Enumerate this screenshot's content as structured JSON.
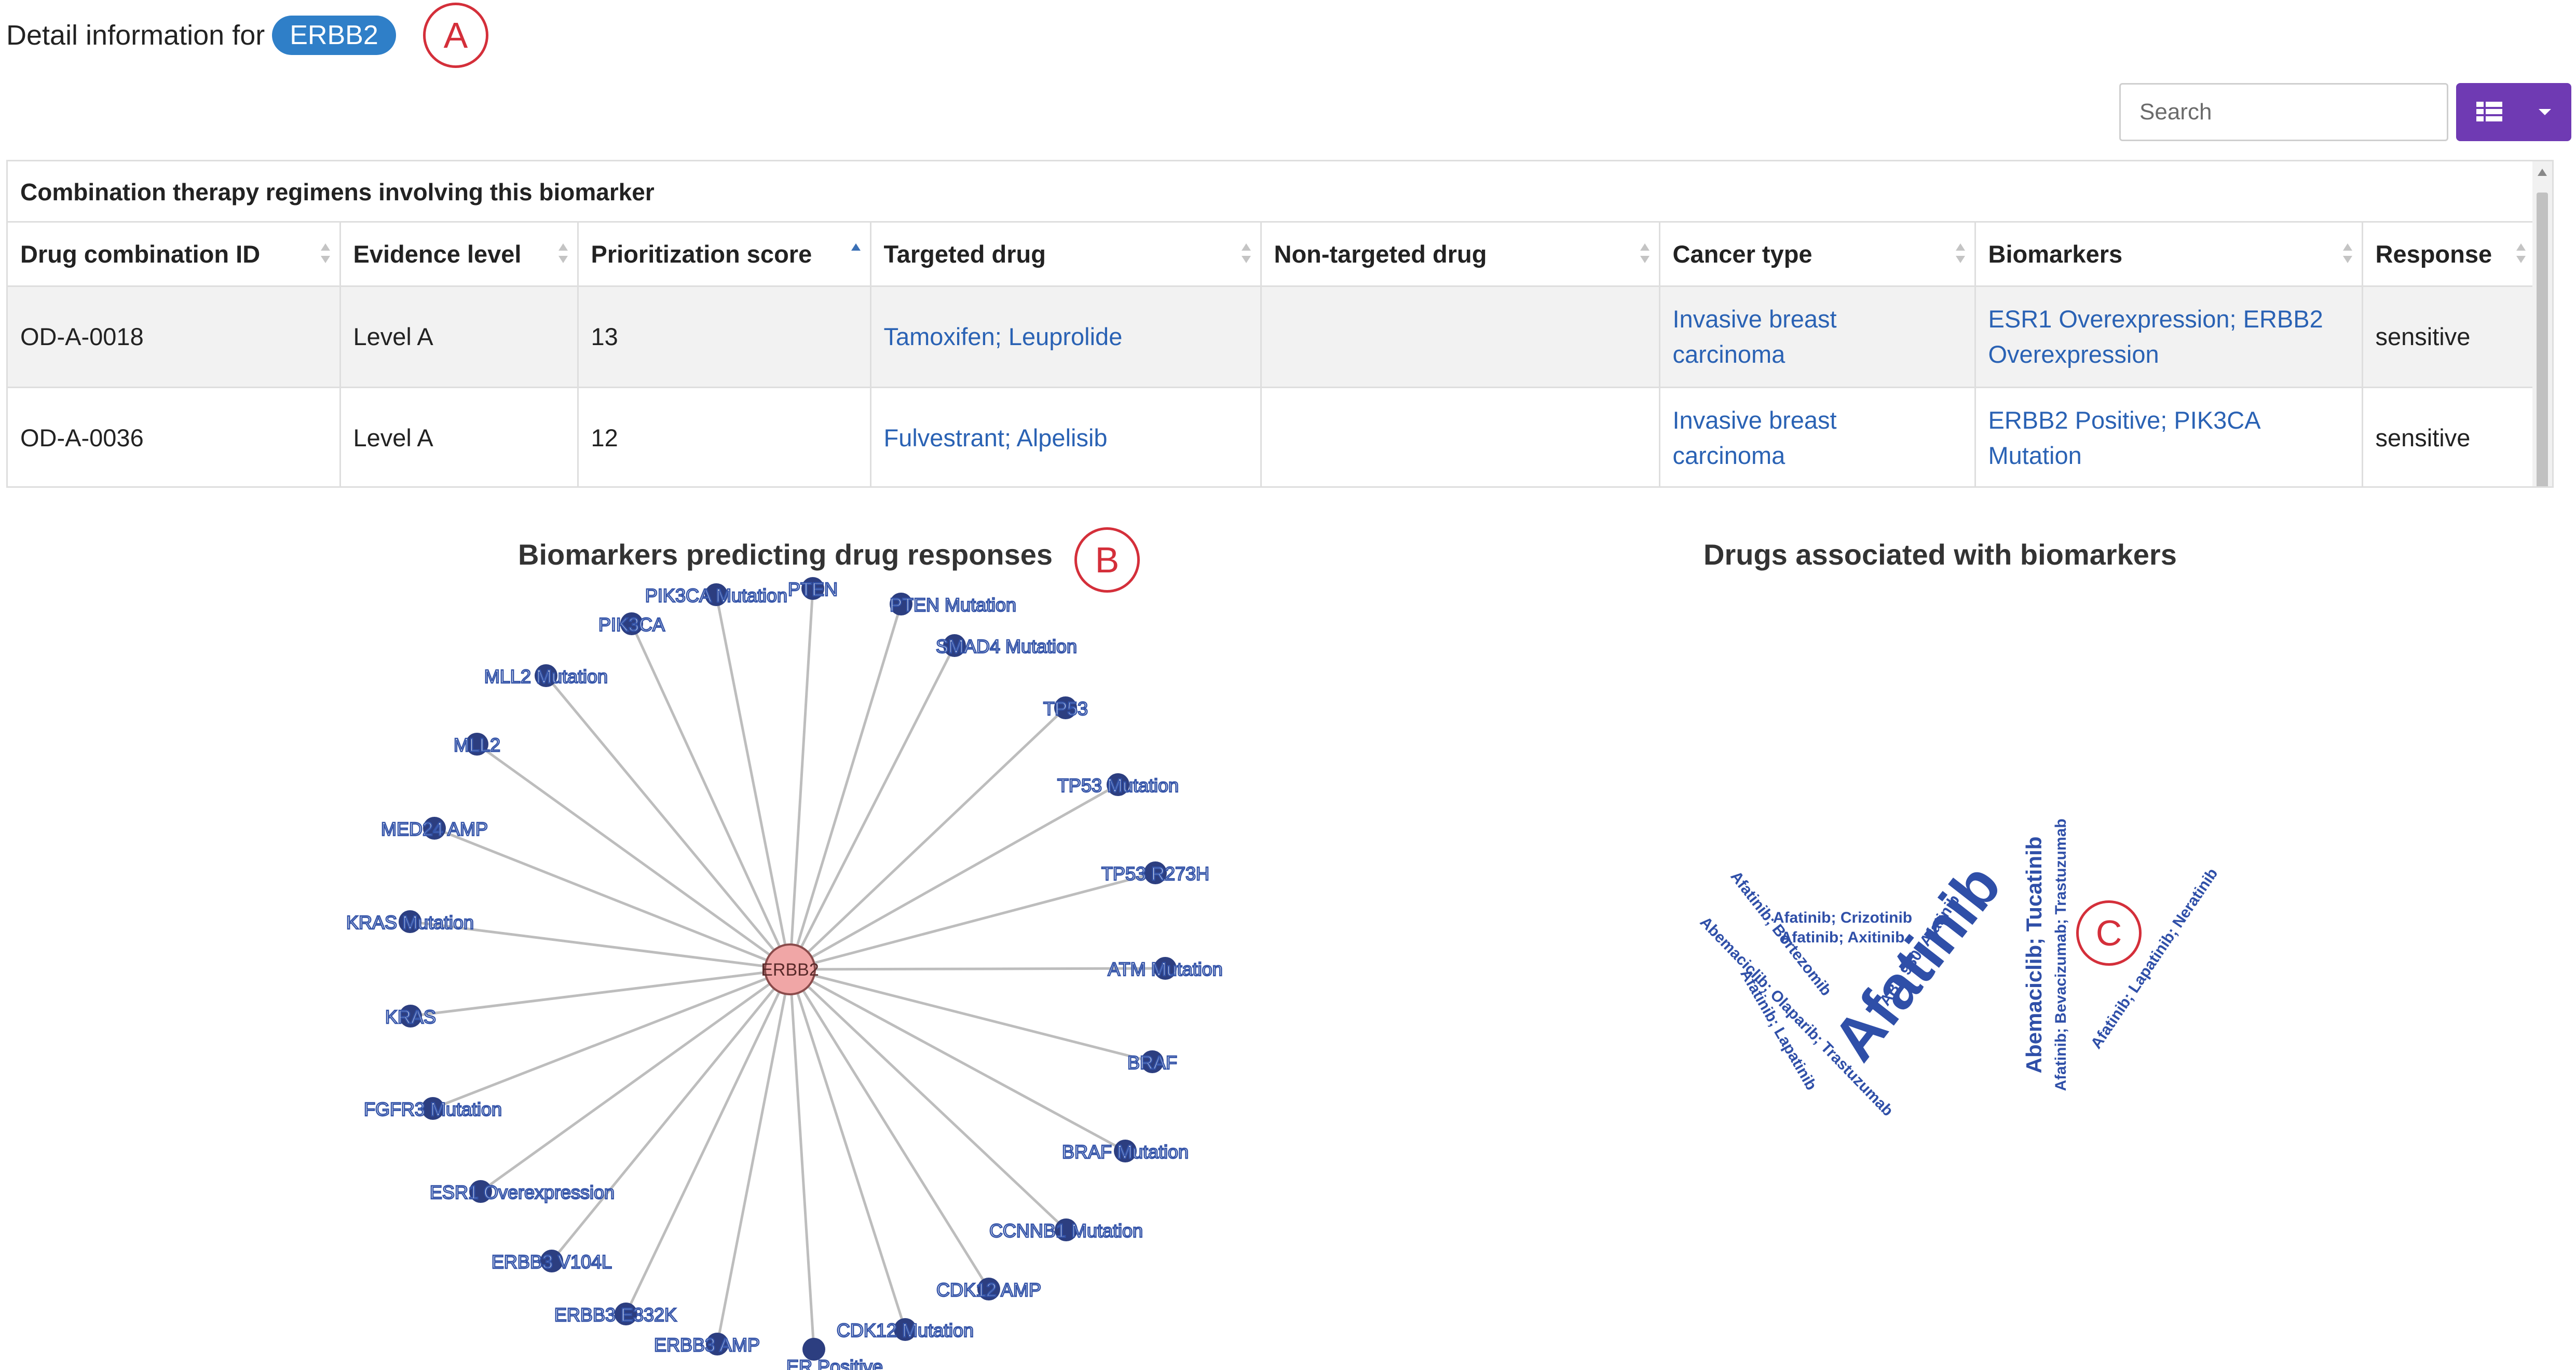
{
  "header": {
    "prefix": "Detail information for",
    "gene_pill": "ERBB2"
  },
  "annotations": {
    "a": "A",
    "b": "B",
    "c": "C"
  },
  "toolbar": {
    "search_placeholder": "Search",
    "view_icon": "table-grid-icon"
  },
  "table": {
    "caption": "Combination therapy regimens involving this biomarker",
    "columns": [
      "Drug combination ID",
      "Evidence level",
      "Prioritization score",
      "Targeted drug",
      "Non-targeted drug",
      "Cancer type",
      "Biomarkers",
      "Response"
    ],
    "sorted_column": "Prioritization score",
    "rows": [
      {
        "id": "OD-A-0018",
        "level": "Level A",
        "score": "13",
        "targeted": "Tamoxifen; Leuprolide",
        "nontargeted": "",
        "cancer_1": "Invasive breast",
        "cancer_2": "carcinoma",
        "bio_1": "ESR1 Overexpression; ERBB2",
        "bio_2": "Overexpression",
        "response": "sensitive"
      },
      {
        "id": "OD-A-0036",
        "level": "Level A",
        "score": "12",
        "targeted": "Fulvestrant; Alpelisib",
        "nontargeted": "",
        "cancer_1": "Invasive breast",
        "cancer_2": "carcinoma",
        "bio_1": "ERBB2 Positive; PIK3CA",
        "bio_2": "Mutation",
        "response": "sensitive"
      }
    ]
  },
  "network": {
    "title": "Biomarkers predicting drug responses",
    "center": "ERBB2",
    "nodes": [
      "PTEN",
      "PTEN Mutation",
      "SMAD4 Mutation",
      "TP53",
      "TP53 Mutation",
      "TP53 R273H",
      "ATM Mutation",
      "BRAF",
      "BRAF Mutation",
      "CCNNB1 Mutation",
      "CDK12 AMP",
      "CDK12 Mutation",
      "ER Positive",
      "ERBB3 AMP",
      "ERBB3 E332K",
      "ERBB3 V104L",
      "ESR1 Overexpression",
      "FGFR3 Mutation",
      "KRAS",
      "KRAS Mutation",
      "MED24 AMP",
      "MLL2",
      "MLL2 Mutation",
      "PIK3CA",
      "PIK3CA Mutation"
    ],
    "colors": {
      "node": "#2c3e80",
      "center": "#f0a6a6",
      "edge": "#bdbdbd",
      "label": "#3353a8"
    }
  },
  "wordcloud": {
    "title": "Drugs associated with biomarkers",
    "words": [
      "Afatinib",
      "Afatinib; Crizotinib",
      "Afatinib; Axitinib",
      "Afatinib; Bortezomib",
      "Abemaciclib; Olaparib; Trastuzumab",
      "Afatinib; Lapatinib",
      "ABP 980; Afatinib",
      "Abemaciclib; Tucatinib",
      "Afatinib; Bevacizumab; Trastuzumab",
      "Afatinib; Lapatinib; Neratinib"
    ],
    "color": "#2f4fa8"
  }
}
